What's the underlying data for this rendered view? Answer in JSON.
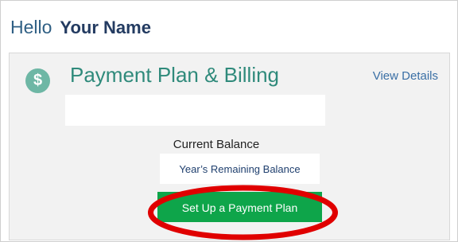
{
  "header": {
    "greeting": "Hello",
    "user_name": "Your Name"
  },
  "card": {
    "icon": "dollar-icon",
    "icon_glyph": "$",
    "title": "Payment Plan & Billing",
    "view_details_label": "View Details",
    "current_balance_label": "Current Balance",
    "remaining_balance_label": "Year’s Remaining Balance",
    "setup_button_label": "Set Up a Payment Plan"
  },
  "annotation": {
    "highlight": "red ellipse around Set Up a Payment Plan button",
    "color": "#e00000"
  },
  "colors": {
    "accent_teal": "#2f8a7b",
    "icon_bg": "#6eb7a5",
    "link_blue": "#3a6fa5",
    "button_green": "#0ea54a",
    "name_navy": "#233b61"
  }
}
